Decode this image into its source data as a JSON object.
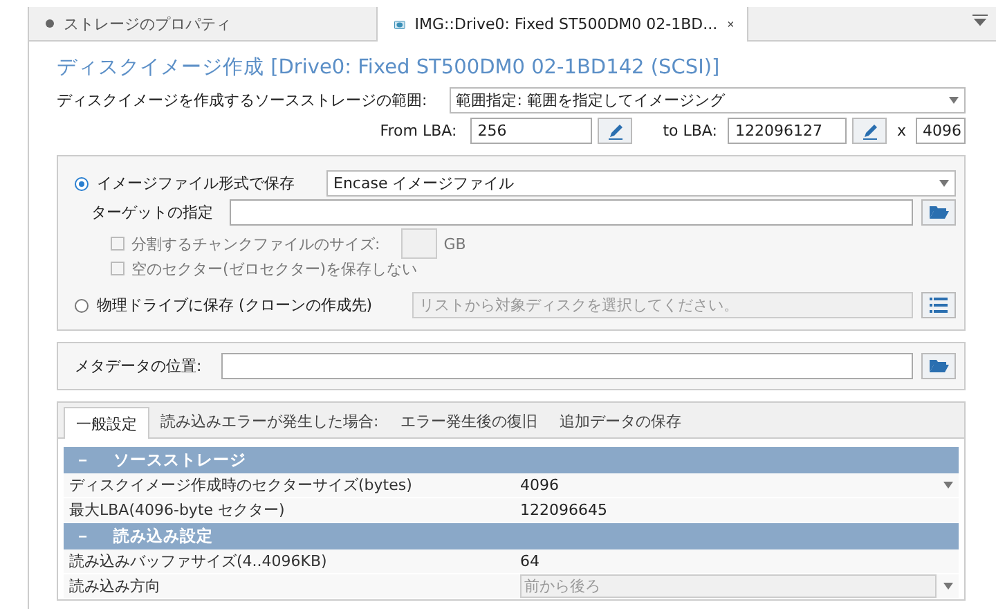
{
  "doc_tabs": [
    {
      "label": "ストレージのプロパティ",
      "selected": false,
      "kind": "properties"
    },
    {
      "label": "IMG::Drive0: Fixed ST500DM0 02-1BD...",
      "selected": true,
      "kind": "image"
    }
  ],
  "title": "ディスクイメージ作成 [Drive0: Fixed ST500DM0 02-1BD142 (SCSI)]",
  "source_range": {
    "label": "ディスクイメージを作成するソースストレージの範囲:",
    "value": "範囲指定: 範囲を指定してイメージング"
  },
  "lba": {
    "from_label": "From LBA:",
    "from": "256",
    "to_label": "to LBA:",
    "to": "122096127",
    "multiplier_label": "x",
    "multiplier": "4096"
  },
  "image_file": {
    "label": "イメージファイル形式で保存",
    "selected": true,
    "format": "Encase イメージファイル"
  },
  "target": {
    "label": "ターゲットの指定"
  },
  "options": [
    {
      "label": "分割するチャンクファイルのサイズ:",
      "checked": false,
      "disabled": true,
      "unit": "GB"
    },
    {
      "label": "空のセクター(ゼロセクター)を保存しない",
      "checked": false,
      "disabled": true
    }
  ],
  "physical_drive": {
    "label": "物理ドライブに保存 (クローンの作成先)",
    "selected": false,
    "placeholder": "リストから対象ディスクを選択してください。"
  },
  "metadata": {
    "label": "メタデータの位置:"
  },
  "settings_tabs": [
    {
      "label": "一般設定",
      "selected": true
    },
    {
      "label": "読み込みエラーが発生した場合:",
      "selected": false
    },
    {
      "label": "エラー発生後の復旧",
      "selected": false
    },
    {
      "label": "追加データの保存",
      "selected": false
    }
  ],
  "grid": [
    {
      "toggle": "－",
      "section": "ソースストレージ",
      "rows": [
        {
          "name": "ディスクイメージ作成時のセクターサイズ(bytes)",
          "value": "4096",
          "kind": "dropdown"
        },
        {
          "name": "最大LBA(4096-byte セクター)",
          "value": "122096645",
          "kind": "text"
        }
      ]
    },
    {
      "toggle": "－",
      "section": "読み込み設定",
      "rows": [
        {
          "name": "読み込みバッファサイズ(4..4096KB)",
          "value": "64",
          "kind": "text"
        },
        {
          "name": "読み込み方向",
          "value": "前から後ろ",
          "kind": "locked-dropdown"
        }
      ]
    }
  ]
}
